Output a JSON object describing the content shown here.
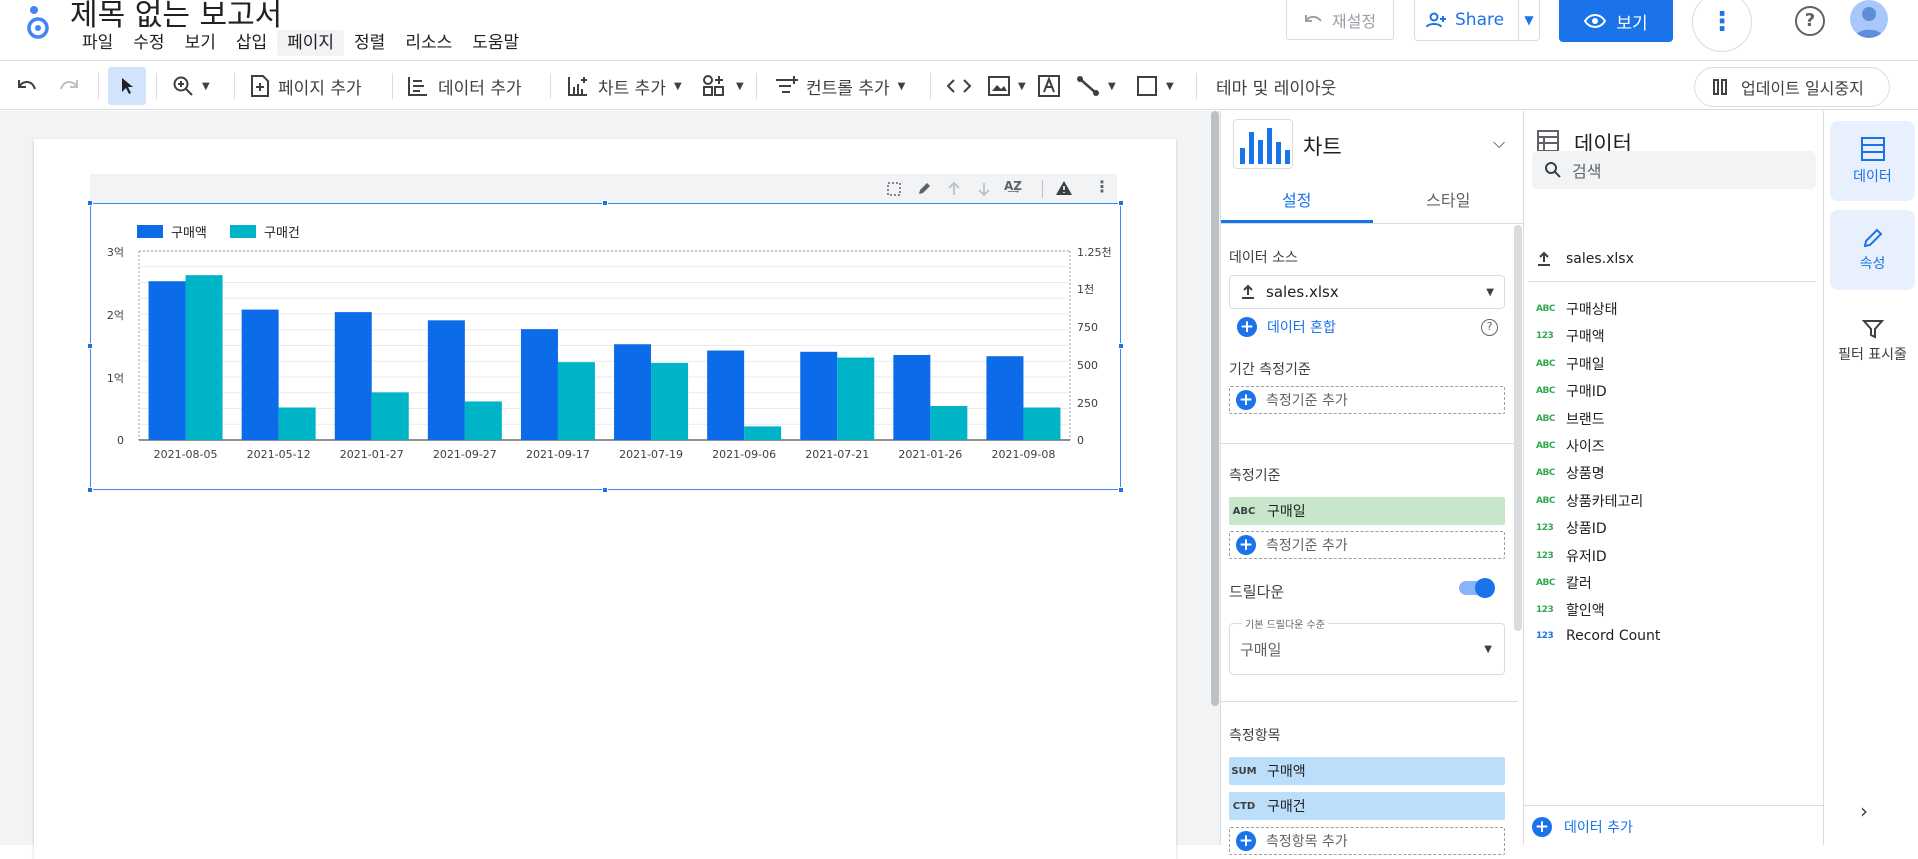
{
  "header": {
    "title": "제목 없는 보고서",
    "menu": [
      "파일",
      "수정",
      "보기",
      "삽입",
      "페이지",
      "정렬",
      "리소스",
      "도움말"
    ],
    "active_menu": "페이지",
    "reset_label": "재설정",
    "share_label": "Share",
    "view_label": "보기"
  },
  "toolbar": {
    "add_page": "페이지 추가",
    "add_data": "데이터 추가",
    "add_chart": "차트 추가",
    "add_control": "컨트롤 추가",
    "theme": "테마 및 레이아웃",
    "pause_update": "업데이트 일시중지"
  },
  "chart": {
    "legend": [
      "구매액",
      "구매건"
    ],
    "left_ticks": [
      "3억",
      "2억",
      "1억",
      "0"
    ],
    "right_ticks": [
      "1.25천",
      "1천",
      "750",
      "500",
      "250",
      "0"
    ]
  },
  "chart_data": {
    "type": "bar",
    "categories": [
      "2021-08-05",
      "2021-05-12",
      "2021-01-27",
      "2021-09-27",
      "2021-09-17",
      "2021-07-19",
      "2021-09-06",
      "2021-07-21",
      "2021-01-26",
      "2021-09-08"
    ],
    "series": [
      {
        "name": "구매액",
        "axis": "left",
        "color": "#0b6be8",
        "values": [
          252000000,
          207000000,
          203000000,
          190000000,
          176000000,
          152000000,
          142000000,
          140000000,
          135000000,
          133000000
        ]
      },
      {
        "name": "구매건",
        "axis": "right",
        "color": "#00b4c8",
        "values": [
          1090,
          215,
          315,
          255,
          515,
          510,
          90,
          545,
          225,
          215
        ]
      }
    ],
    "ylim_left": [
      0,
      300000000
    ],
    "ylim_right": [
      0,
      1250
    ],
    "ylabel": "",
    "xlabel": ""
  },
  "chart_panel": {
    "title": "차트",
    "tab_setup": "설정",
    "tab_style": "스타일",
    "data_source_label": "데이터 소스",
    "data_source_value": "sales.xlsx",
    "blend_label": "데이터 혼합",
    "date_range_label": "기간 측정기준",
    "add_dimension": "측정기준 추가",
    "dimension_label": "측정기준",
    "dimension_field": "구매일",
    "dimension_tag": "ABC",
    "drilldown_label": "드릴다운",
    "drilldown_level_label": "기본 드릴다운 수준",
    "drilldown_level_value": "구매일",
    "metric_label": "측정항목",
    "metrics": [
      {
        "tag": "SUM",
        "name": "구매액"
      },
      {
        "tag": "CTD",
        "name": "구매건"
      }
    ],
    "add_metric": "측정항목 추가"
  },
  "data_panel": {
    "title": "데이터",
    "search_placeholder": "검색",
    "source": "sales.xlsx",
    "fields": [
      {
        "type": "ABC",
        "name": "구매상태"
      },
      {
        "type": "123",
        "name": "구매액"
      },
      {
        "type": "ABC",
        "name": "구매일"
      },
      {
        "type": "ABC",
        "name": "구매ID"
      },
      {
        "type": "ABC",
        "name": "브랜드"
      },
      {
        "type": "ABC",
        "name": "사이즈"
      },
      {
        "type": "ABC",
        "name": "상품명"
      },
      {
        "type": "ABC",
        "name": "상품카테고리"
      },
      {
        "type": "123",
        "name": "상품ID"
      },
      {
        "type": "123",
        "name": "유저ID"
      },
      {
        "type": "ABC",
        "name": "칼러"
      },
      {
        "type": "123",
        "name": "할인액"
      },
      {
        "type": "123",
        "name": "Record Count"
      }
    ],
    "add_data": "데이터 추가"
  },
  "side": {
    "data": "데이터",
    "props": "속성",
    "filter": "필터 표시줄"
  }
}
